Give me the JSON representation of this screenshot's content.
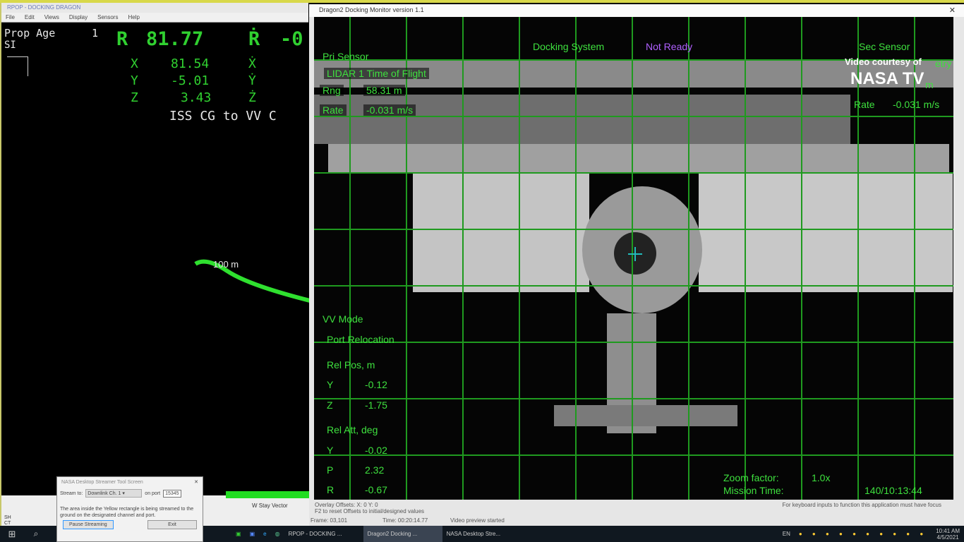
{
  "left_window": {
    "title": "RPOP - DOCKING DRAGON",
    "menu": [
      "File",
      "Edit",
      "Views",
      "Display",
      "Sensors",
      "Help"
    ],
    "prop_age_label": "Prop Age",
    "prop_age_value": "1",
    "frame": "SI",
    "r_label": "R",
    "r_value": "81.77",
    "rdot_label": "Ṙ",
    "rdot_value": "-0",
    "rows": [
      {
        "axis": "X",
        "value": "81.54",
        "dot": "Ẋ"
      },
      {
        "axis": "Y",
        "value": "-5.01",
        "dot": "Ẏ"
      },
      {
        "axis": "Z",
        "value": "3.43",
        "dot": "Ż"
      }
    ],
    "reference": "ISS CG to VV C",
    "range_marker": "100 m",
    "bottom_label": "W Stay Vector",
    "side_labels": [
      "SH",
      "CT"
    ]
  },
  "right_window": {
    "title": "Dragon2 Docking Monitor version 1.1",
    "pri_sensor": "Pri Sensor",
    "sensor_mode": "LIDAR 1 Time of Flight",
    "rng_label": "Rng",
    "rng_value": "58.31 m",
    "rate_label": "Rate",
    "rate_value": "-0.031 m/s",
    "docking_system_label": "Docking System",
    "docking_status": "Not Ready",
    "sec_sensor": "Sec Sensor",
    "sec_extra": "etry",
    "sec_rng": "m",
    "sec_rate_label": "Rate",
    "sec_rate_value": "-0.031 m/s",
    "vv_mode": "VV Mode",
    "port": "Port Relocation",
    "rel_pos_label": "Rel Pos, m",
    "rel_pos": [
      {
        "axis": "Y",
        "value": "-0.12"
      },
      {
        "axis": "Z",
        "value": "-1.75"
      }
    ],
    "rel_att_label": "Rel Att, deg",
    "rel_att": [
      {
        "axis": "Y",
        "value": "-0.02"
      },
      {
        "axis": "P",
        "value": "2.32"
      },
      {
        "axis": "R",
        "value": "-0.67"
      }
    ],
    "zoom_label": "Zoom factor:",
    "zoom_value": "1.0x",
    "mission_time_label": "Mission Time:",
    "mission_time_value": "140/10:13:44",
    "overlay_offsets": "Overlay Offsets:  X: 0    Y: 0",
    "reset_hint": "F2 to reset Offsets to initial/designed values",
    "focus_hint": "For keyboard inputs to function this application must have focus",
    "frame": "Frame: 03,101",
    "time": "Time: 00:20:14.77",
    "video_status": "Video preview started",
    "watermark_line1": "Video courtesy of",
    "watermark_line2": "NASA TV"
  },
  "dialog": {
    "title": "NASA Desktop Streamer Tool Screen",
    "stream_label": "Stream to:",
    "stream_value": "Downlink Ch. 1",
    "port_label": "on port",
    "port_value": "15345",
    "info": "The area inside the Yellow rectangle is being streamed to the ground on the designated channel and port.",
    "pause_button": "Pause Streaming",
    "exit_button": "Exit"
  },
  "taskbar": {
    "items": [
      "RPOP - DOCKING ...",
      "Dragon2 Docking ...",
      "NASA Desktop Stre..."
    ],
    "time": "10:41 AM",
    "date": "4/5/2021",
    "lang": "EN"
  }
}
